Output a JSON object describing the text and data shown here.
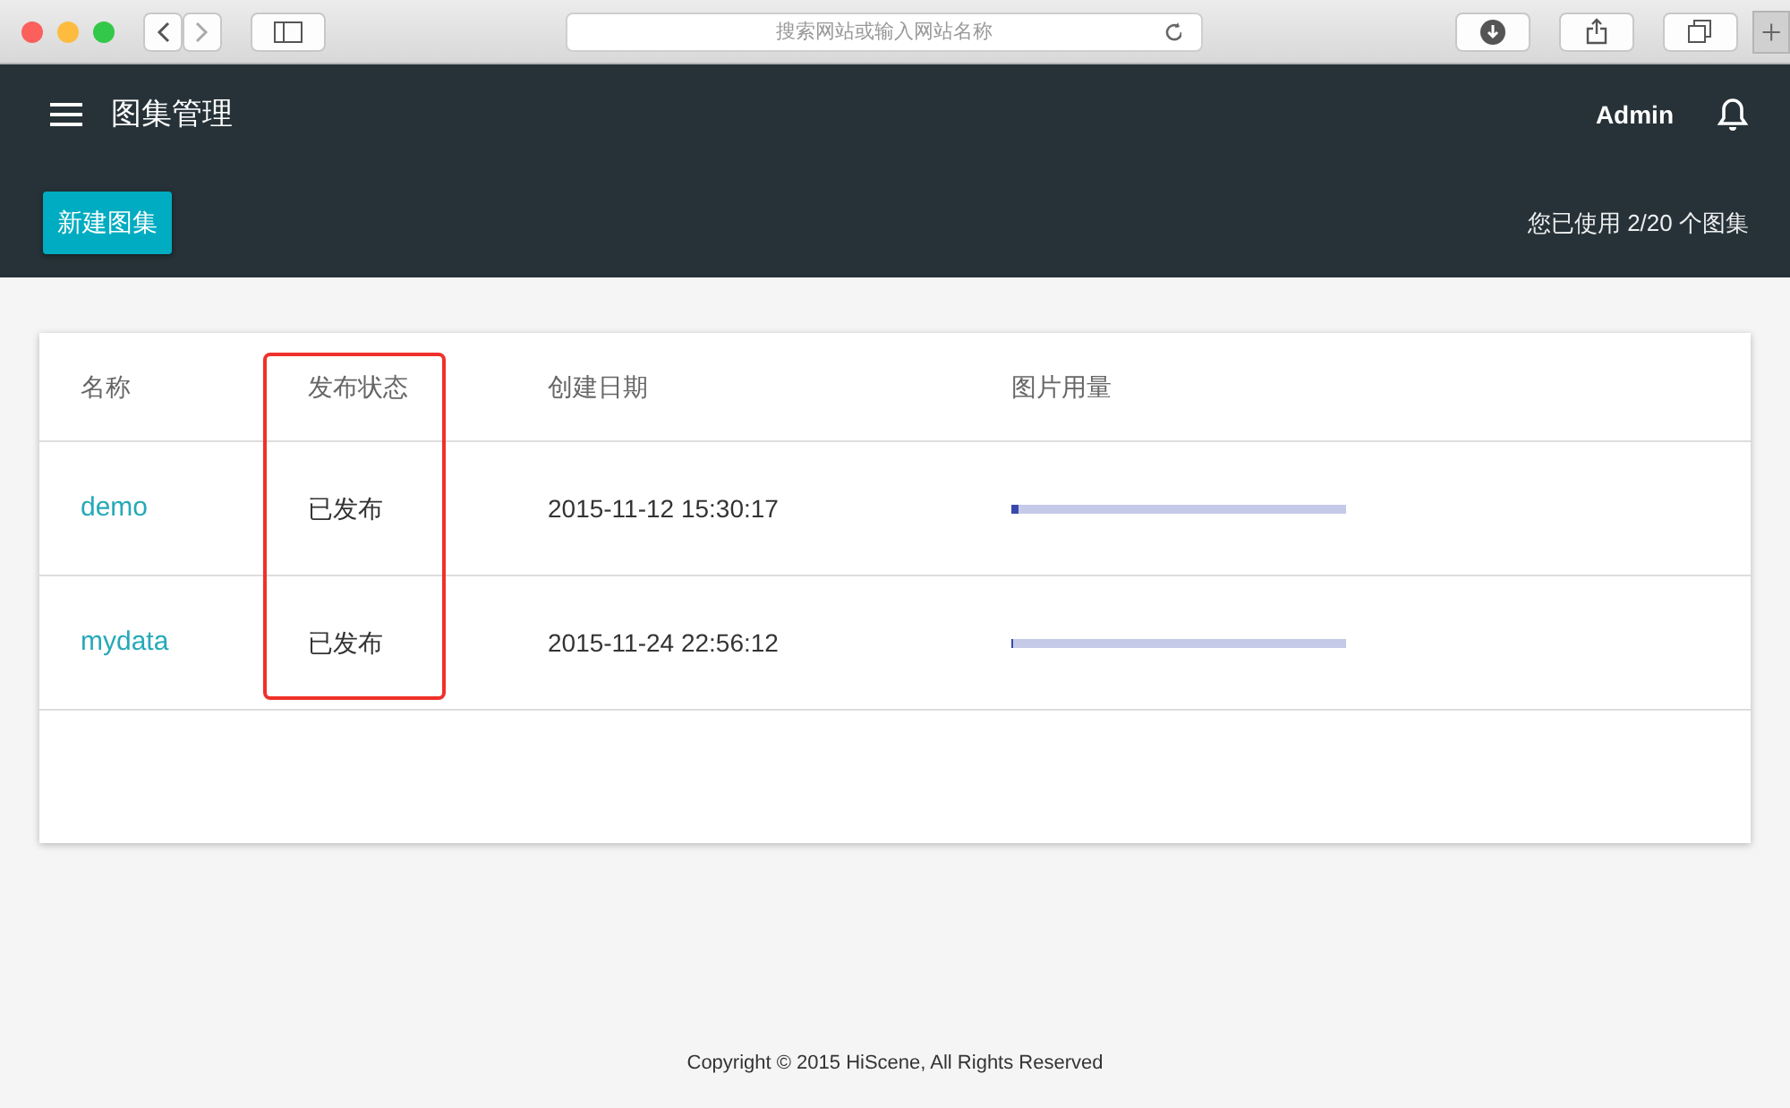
{
  "browser": {
    "address_placeholder": "搜索网站或输入网站名称"
  },
  "app_bar": {
    "title": "图集管理",
    "user": "Admin"
  },
  "toolbar": {
    "new_button": "新建图集",
    "usage": "您已使用 2/20 个图集"
  },
  "table": {
    "columns": [
      {
        "label": "名称",
        "highlighted": false
      },
      {
        "label": "发布状态",
        "highlighted": true
      },
      {
        "label": "创建日期",
        "highlighted": false
      },
      {
        "label": "图片用量",
        "highlighted": false
      }
    ],
    "rows": [
      {
        "name": "demo",
        "status": "已发布",
        "created": "2015-11-12 15:30:17",
        "level": 0.02
      },
      {
        "name": "mydata",
        "status": "已发布",
        "created": "2015-11-24 22:56:12",
        "level": 0
      }
    ]
  },
  "footer": "Copyright © 2015 HiScene, All Rights Reserved"
}
